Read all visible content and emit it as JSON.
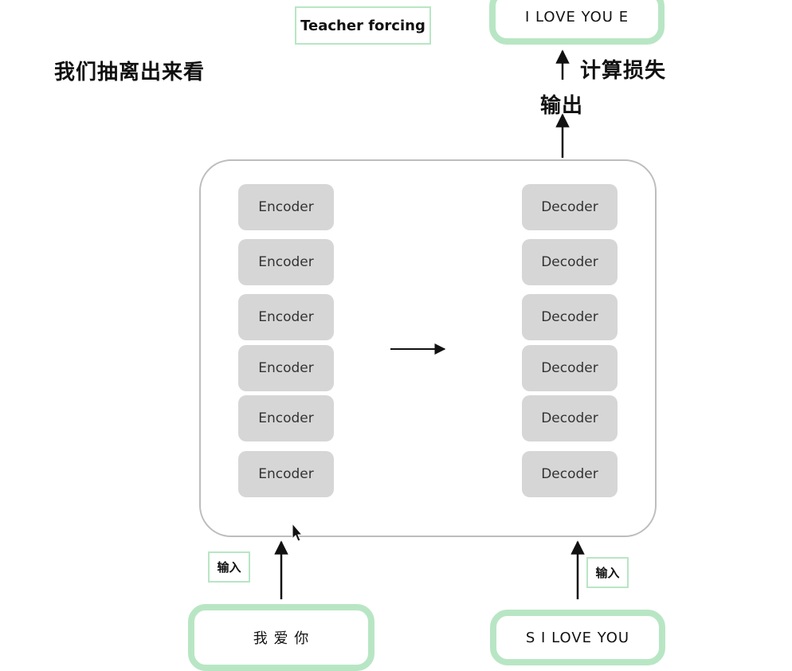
{
  "heading": "我们抽离出来看",
  "teacher_forcing_label": "Teacher forcing",
  "output_sequence": "I LOVE YOU E",
  "loss_label": "计算损失",
  "output_label": "输出",
  "encoder_label": "Encoder",
  "decoder_label": "Decoder",
  "input_label": "输入",
  "encoder_input": "我 爱 你",
  "decoder_input": "S I LOVE YOU",
  "colors": {
    "accent_green": "#b8e6c4",
    "block_gray": "#d6d6d6",
    "frame_gray": "#bdbdbd"
  }
}
